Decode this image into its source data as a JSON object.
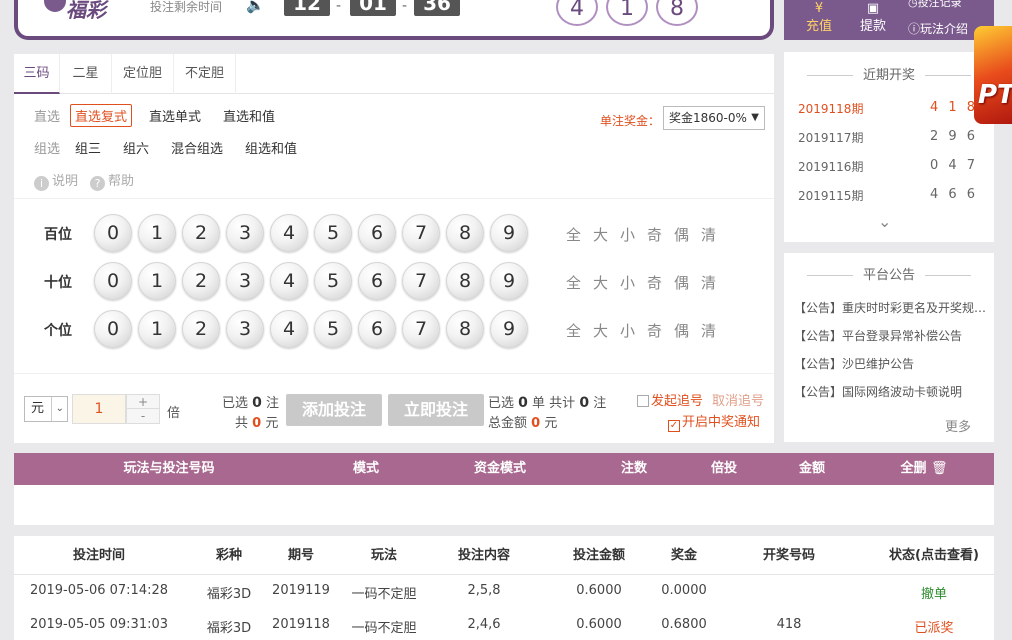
{
  "header": {
    "logo_text": "福彩",
    "countdown_label": "投注剩余时间",
    "countdown": [
      "12",
      "01",
      "36"
    ],
    "last_numbers": [
      "4",
      "1",
      "8"
    ],
    "recharge": "充值",
    "withdraw": "提款",
    "bet_record": "投注记录",
    "play_intro": "玩法介绍"
  },
  "tabs": [
    "三码",
    "二星",
    "定位胆",
    "不定胆"
  ],
  "subplays": {
    "direct_label": "直选",
    "direct": [
      "直选复式",
      "直选单式",
      "直选和值"
    ],
    "group_label": "组选",
    "group": [
      "组三",
      "组六",
      "混合组选",
      "组选和值"
    ],
    "explain": "说明",
    "help": "帮助",
    "prize_label": "单注奖金：",
    "prize_value": "奖金1860-0%"
  },
  "picker": {
    "rows": [
      "百位",
      "十位",
      "个位"
    ],
    "digits": [
      "0",
      "1",
      "2",
      "3",
      "4",
      "5",
      "6",
      "7",
      "8",
      "9"
    ],
    "quick": [
      "全",
      "大",
      "小",
      "奇",
      "偶",
      "清"
    ]
  },
  "betbar": {
    "unit": "元",
    "multiple": "1",
    "plus": "+",
    "minus": "-",
    "multiple_suffix": "倍",
    "selected_prefix": "已选",
    "selected_count": "0",
    "selected_unit": "注",
    "total_prefix": "共",
    "total_amount": "0",
    "total_unit": "元",
    "add_bet": "添加投注",
    "bet_now": "立即投注",
    "sum_selected_prefix": "已选",
    "sum_selected_count": "0",
    "sum_selected_unit": "单 共计",
    "sum_bets": "0",
    "sum_bets_unit": "注",
    "total_money_label": "总金额",
    "total_money": "0",
    "total_money_unit": "元",
    "chase_label": "发起追号",
    "cancel_chase": "取消追号",
    "win_notify": "开启中奖通知"
  },
  "ticket_table": {
    "columns": [
      "玩法与投注号码",
      "模式",
      "资金模式",
      "注数",
      "倍投",
      "金额",
      "全删"
    ]
  },
  "history": {
    "columns": [
      "投注时间",
      "彩种",
      "期号",
      "玩法",
      "投注内容",
      "投注金额",
      "奖金",
      "开奖号码",
      "状态(点击查看)"
    ],
    "rows": [
      [
        "2019-05-06 07:14:28",
        "福彩3D",
        "2019119",
        "一码不定胆",
        "2,5,8",
        "0.6000",
        "0.0000",
        "",
        "撤单"
      ],
      [
        "2019-05-05 09:31:03",
        "福彩3D",
        "2019118",
        "一码不定胆",
        "2,4,6",
        "0.6000",
        "0.6800",
        "418",
        "已派奖"
      ]
    ],
    "status_colors": [
      "#2e8b2e",
      "#e0501f"
    ]
  },
  "recent_draws": {
    "title": "近期开奖",
    "rows": [
      {
        "period": "2019118期",
        "numbers": "4 1 8"
      },
      {
        "period": "2019117期",
        "numbers": "2 9 6"
      },
      {
        "period": "2019116期",
        "numbers": "0 4 7"
      },
      {
        "period": "2019115期",
        "numbers": "4 6 6"
      }
    ]
  },
  "announcements": {
    "title": "平台公告",
    "items": [
      "【公告】重庆时时彩更名及开奖规则调整",
      "【公告】平台登录异常补偿公告",
      "【公告】沙巴维护公告",
      "【公告】国际网络波动卡顿说明"
    ],
    "more": "更多"
  },
  "float_ad": {
    "text": "PT"
  },
  "colors": {
    "brand": "#7a5a8c",
    "accent": "#e0501f",
    "table_header": "#a9688f"
  }
}
